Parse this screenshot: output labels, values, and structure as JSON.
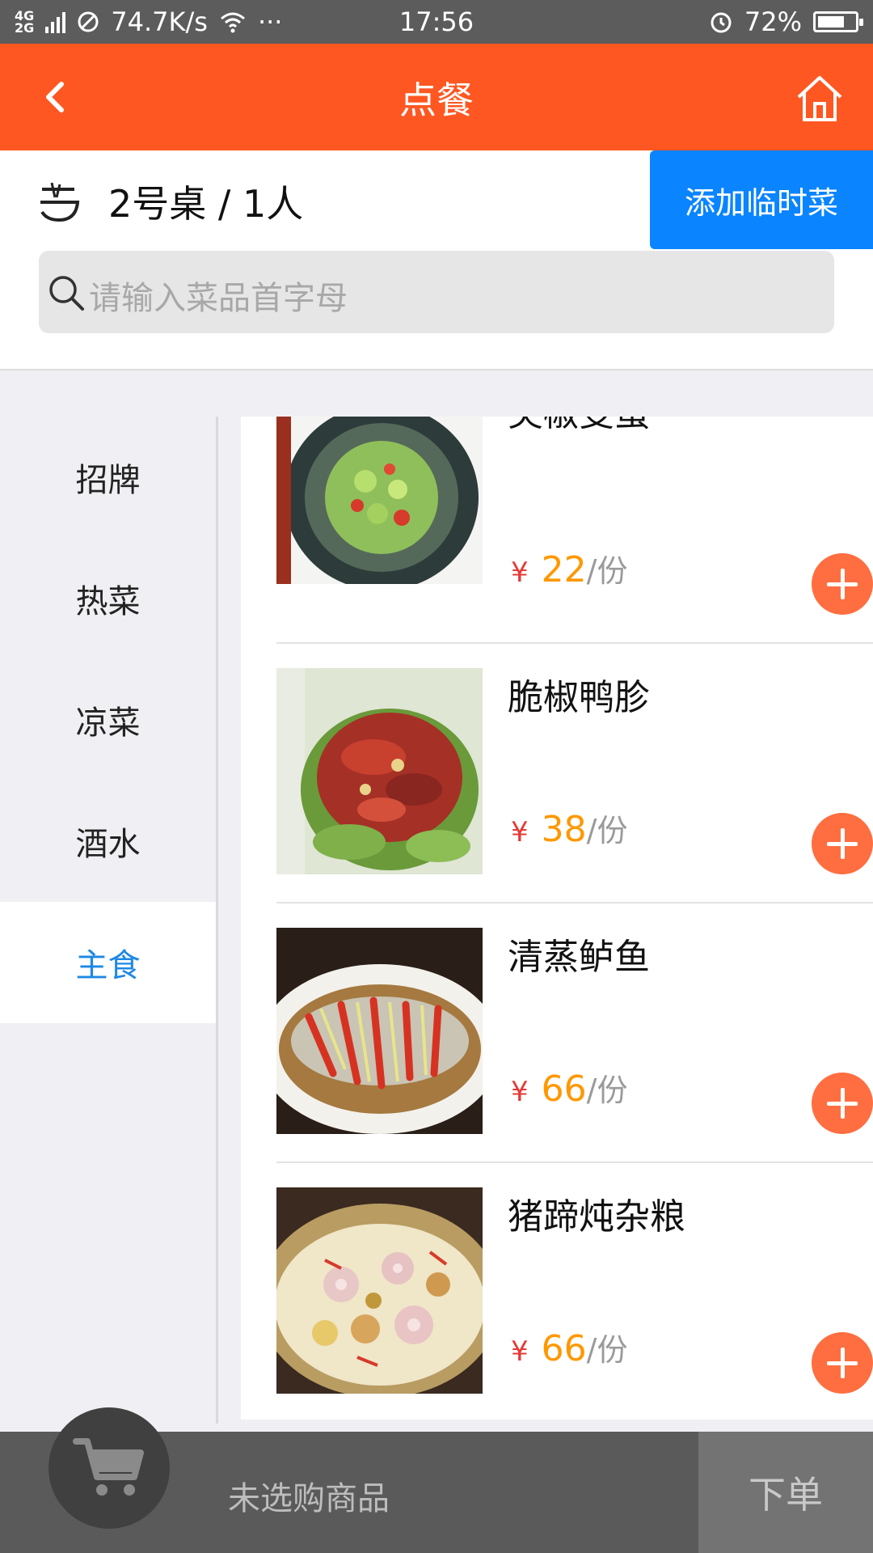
{
  "status_bar": {
    "network_type": "4G 2G",
    "speed": "74.7K/s",
    "more": "···",
    "time": "17:56",
    "battery": "72%",
    "battery_level": 0.72
  },
  "nav": {
    "title": "点餐",
    "back_icon": "chevron-left-icon",
    "home_icon": "home-icon",
    "color": "#ff5722"
  },
  "table": {
    "label": "2号桌 / 1人",
    "icon": "bowl-icon",
    "add_temp_button": "添加临时菜",
    "button_color": "#0a84ff"
  },
  "search": {
    "placeholder": "请输入菜品首字母",
    "icon": "search-icon"
  },
  "categories": [
    {
      "label": "招牌",
      "active": false
    },
    {
      "label": "热菜",
      "active": false
    },
    {
      "label": "凉菜",
      "active": false
    },
    {
      "label": "酒水",
      "active": false
    },
    {
      "label": "主食",
      "active": true
    }
  ],
  "dishes": [
    {
      "name": "尖椒变蛋",
      "yen": "¥",
      "price": "22",
      "unit": "/份",
      "image": "preserved-egg-photo"
    },
    {
      "name": "脆椒鸭胗",
      "yen": "¥",
      "price": "38",
      "unit": "/份",
      "image": "duck-gizzard-photo"
    },
    {
      "name": "清蒸鲈鱼",
      "yen": "¥",
      "price": "66",
      "unit": "/份",
      "image": "steamed-fish-photo"
    },
    {
      "name": "猪蹄炖杂粮",
      "yen": "¥",
      "price": "66",
      "unit": "/份",
      "image": "pork-trotter-stew-photo"
    }
  ],
  "bottom_bar": {
    "cart_icon": "shopping-cart-icon",
    "empty_text": "未选购商品",
    "submit_label": "下单"
  },
  "colors": {
    "accent_orange": "#ff5722",
    "price": "#ff9800",
    "yen": "#e53935",
    "active_category": "#1e88e5",
    "add_button": "#ff6e40"
  }
}
